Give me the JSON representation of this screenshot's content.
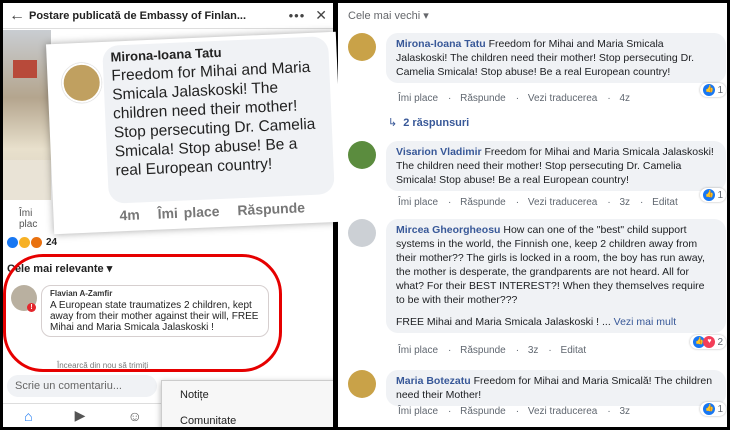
{
  "left": {
    "header_title": "Postare publicată de Embassy of Finlan...",
    "like_label": "Îmi plac",
    "reaction_count": "24",
    "sort_label": "Cele mai relevante",
    "flavian": {
      "name": "Flavian A-Zamfir",
      "text": "A European state traumatizes 2 children, kept away from their mother against their will, FREE Mihai and Maria Smicala Jalaskoski !",
      "retry": "Încearcă din nou să trimiți"
    },
    "write_placeholder": "Scrie un comentariu...",
    "menu": [
      "Notițe",
      "Comunitate"
    ]
  },
  "zoom": {
    "name": "Mirona-Ioana Tatu",
    "text": "Freedom for Mihai and Maria Smicala Jalaskoski! The children need their mother! Stop persecuting Dr. Camelia Smicala! Stop abuse! Be a real European country!",
    "time": "4m",
    "like": "Îmi place",
    "reply": "Răspunde"
  },
  "right": {
    "sort": "Cele mai vechi",
    "comments": [
      {
        "name": "Mirona-Ioana Tatu",
        "text": "Freedom for Mihai and Maria Smicala Jalaskoski! The children need their mother! Stop persecuting Dr. Camelia Smicala! Stop abuse! Be a real European country!",
        "like": "Îmi place",
        "reply": "Răspunde",
        "translate": "Vezi traducerea",
        "time": "4z",
        "likes": "1"
      },
      {
        "name": "Visarion Vladimir",
        "text": "Freedom for Mihai and Maria Smicala Jalaskoski! The children need their mother! Stop persecuting Dr. Camelia Smicala! Stop abuse! Be a real European country!",
        "like": "Îmi place",
        "reply": "Răspunde",
        "translate": "Vezi traducerea",
        "time": "3z",
        "edited": "Editat",
        "likes": "1"
      },
      {
        "name": "Mircea Gheorgheosu",
        "text": "How can one of the \"best\" child support systems in the world, the Finnish one, keep 2 children away from their mother?? The girls is locked in a room, the boy has run away, the mother is desperate, the grandparents are not heard. All for what? For their BEST INTEREST?! When they themselves require to be with their mother???",
        "text2": "FREE Mihai and Maria Smicala Jalaskoski ! ...",
        "more": "Vezi mai mult",
        "like": "Îmi place",
        "reply": "Răspunde",
        "time": "3z",
        "edited": "Editat",
        "likes": "2"
      },
      {
        "name": "Maria Botezatu",
        "text": "Freedom for Mihai and Maria Smicală! The children need their Mother!",
        "like": "Îmi place",
        "reply": "Răspunde",
        "translate": "Vezi traducerea",
        "time": "3z",
        "likes": "1"
      }
    ],
    "replies": "2 răspunsuri"
  }
}
